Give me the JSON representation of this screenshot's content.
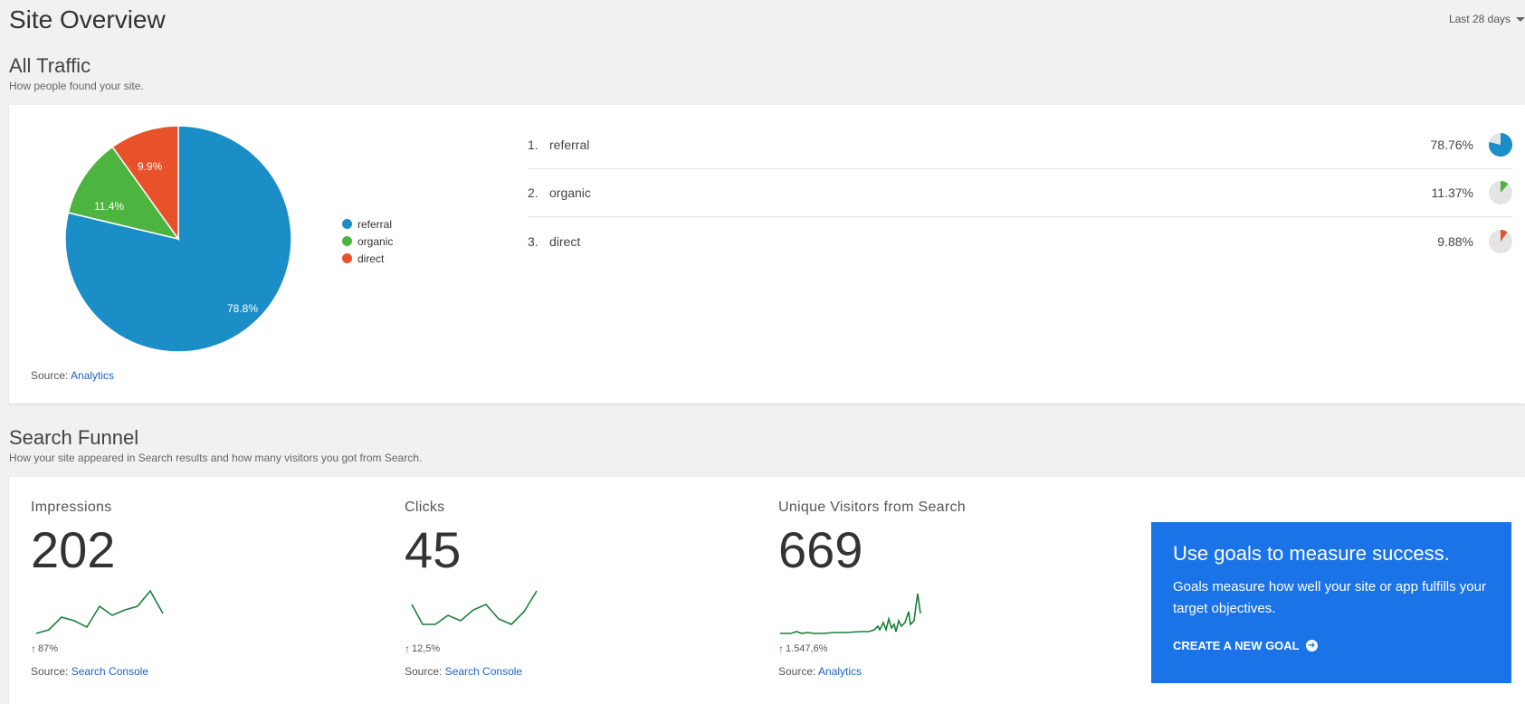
{
  "header": {
    "title": "Site Overview",
    "date_range": "Last 28 days"
  },
  "traffic": {
    "title": "All Traffic",
    "subtitle": "How people found your site.",
    "source_prefix": "Source:",
    "source_link": "Analytics",
    "chart_data": {
      "type": "pie",
      "categories": [
        "referral",
        "organic",
        "direct"
      ],
      "values": [
        78.8,
        11.4,
        9.9
      ],
      "labels": [
        "78.8%",
        "11.4%",
        "9.9%"
      ],
      "colors": [
        "#1b8dc7",
        "#4cb43f",
        "#e8522b"
      ],
      "legend": "right"
    },
    "rows": [
      {
        "rank": "1.",
        "name": "referral",
        "pct": "78.76%",
        "value": 78.76,
        "color": "#1b8dc7"
      },
      {
        "rank": "2.",
        "name": "organic",
        "pct": "11.37%",
        "value": 11.37,
        "color": "#4cb43f"
      },
      {
        "rank": "3.",
        "name": "direct",
        "pct": "9.88%",
        "value": 9.88,
        "color": "#e8522b"
      }
    ]
  },
  "funnel": {
    "title": "Search Funnel",
    "subtitle": "How your site appeared in Search results and how many visitors you got from Search.",
    "metrics": [
      {
        "label": "Impressions",
        "value": "202",
        "change": "87%",
        "source_prefix": "Source:",
        "source_link": "Search Console"
      },
      {
        "label": "Clicks",
        "value": "45",
        "change": "12,5%",
        "source_prefix": "Source:",
        "source_link": "Search Console"
      },
      {
        "label": "Unique Visitors from Search",
        "value": "669",
        "change": "1.547,6%",
        "source_prefix": "Source:",
        "source_link": "Analytics"
      }
    ],
    "goal": {
      "title": "Use goals to measure success.",
      "text": "Goals measure how well your site or app fulfills your target objectives.",
      "cta": "CREATE A NEW GOAL"
    },
    "spark_color": "#188038"
  }
}
